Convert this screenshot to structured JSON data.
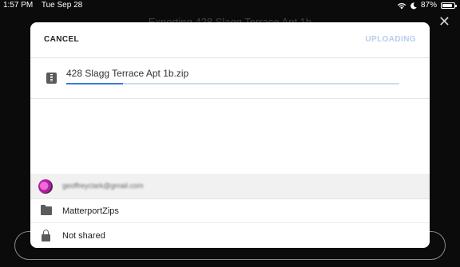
{
  "status_bar": {
    "time": "1:57 PM",
    "date": "Tue Sep 28",
    "battery_text": "87%",
    "battery_level": 0.87
  },
  "background": {
    "title": "Exporting 428 Slagg Terrace Apt 1b",
    "close_glyph": "✕"
  },
  "dialog": {
    "cancel_label": "CANCEL",
    "uploading_label": "UPLOADING",
    "file": {
      "name": "428 Slagg Terrace Apt 1b.zip",
      "progress": 0.17,
      "icon": "zip-file-icon"
    },
    "account": {
      "email": "geoffreyclark@gmail.com"
    },
    "folder": {
      "name": "MatterportZips",
      "icon": "folder-icon"
    },
    "sharing": {
      "label": "Not shared",
      "icon": "lock-icon"
    }
  },
  "colors": {
    "accent": "#3a7bd5",
    "progress_track": "#c9dcf1",
    "uploading_disabled": "#b6cfe8"
  }
}
